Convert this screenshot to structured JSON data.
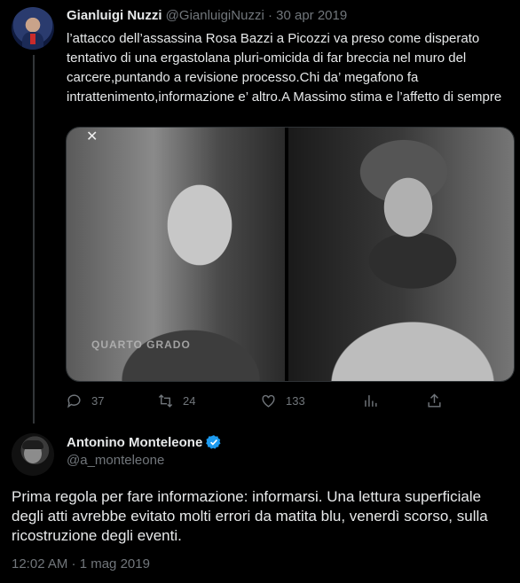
{
  "quoted_tweet": {
    "author_name": "Gianluigi Nuzzi",
    "author_handle": "@GianluigiNuzzi",
    "separator": "·",
    "date": "30 apr 2019",
    "text": "l’attacco dell’assassina Rosa Bazzi a Picozzi va preso come disperato tentativo di una ergastolana pluri-omicida di far breccia nel muro del carcere,puntando a revisione processo.Chi da’ megafono fa intrattenimento,informazione e’ altro.A Massimo stima e l’affetto di sempre",
    "media_watermark": "QUARTO GRADO",
    "actions": {
      "replies": "37",
      "retweets": "24",
      "likes": "133",
      "icons": [
        "reply-icon",
        "retweet-icon",
        "like-icon",
        "views-icon",
        "share-icon"
      ]
    }
  },
  "main_tweet": {
    "author_name": "Antonino Monteleone",
    "author_handle": "@a_monteleone",
    "verified": true,
    "text": "Prima regola per fare informazione: informarsi. Una lettura superficiale degli atti avrebbe evitato molti errori da matita blu, venerdì scorso, sulla ricostruzione degli eventi.",
    "timestamp": "12:02 AM · 1 mag 2019"
  },
  "colors": {
    "background": "#000000",
    "text": "#e7e9ea",
    "secondary": "#71767b",
    "verified_blue": "#1d9bf0",
    "thread_line": "#333639"
  }
}
